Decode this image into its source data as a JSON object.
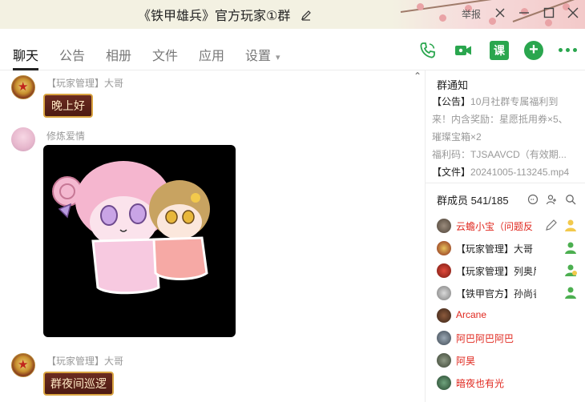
{
  "window": {
    "title": "《铁甲雄兵》官方玩家①群",
    "report_label": "举报"
  },
  "tabs": [
    {
      "label": "聊天"
    },
    {
      "label": "公告"
    },
    {
      "label": "相册"
    },
    {
      "label": "文件"
    },
    {
      "label": "应用"
    },
    {
      "label": "设置"
    }
  ],
  "toolbar": {
    "class_label": "课",
    "add_label": "+"
  },
  "messages": [
    {
      "sender": "【玩家管理】大哥",
      "text": "晚上好"
    },
    {
      "sender": "修炼爱情",
      "sticker": "anime-couple-sticker"
    },
    {
      "sender": "【玩家管理】大哥",
      "text": "群夜间巡逻"
    }
  ],
  "notice": {
    "title": "群通知",
    "line1_tag": "【公告】",
    "line1": "10月社群专属福利到",
    "line2": "来！内含奖励：星愿抵用券×5、",
    "line3": "璀璨宝箱×2",
    "line4": "福利码：TJSAAVCD（有效期..."
  },
  "file": {
    "tag": "【文件】",
    "name": "20241005-113245.mp4"
  },
  "members": {
    "header": "群成员 541/185",
    "list": [
      {
        "name": "云蟾小宝（问题反",
        "color": "#e0281f"
      },
      {
        "name": "【玩家管理】大哥",
        "color": "#222222"
      },
      {
        "name": "【玩家管理】列奥尼达",
        "color": "#222222"
      },
      {
        "name": "【铁甲官方】孙尚香",
        "color": "#222222"
      },
      {
        "name": "Arcane",
        "color": "#e0281f"
      },
      {
        "name": "阿巴阿巴阿巴",
        "color": "#e0281f"
      },
      {
        "name": "阿昊",
        "color": "#e0281f"
      },
      {
        "name": "暗夜也有光",
        "color": "#e0281f"
      }
    ]
  },
  "colors": {
    "accent_green": "#2aa64e",
    "red_name": "#e0281f",
    "bubble_gold": "#d9a441"
  }
}
